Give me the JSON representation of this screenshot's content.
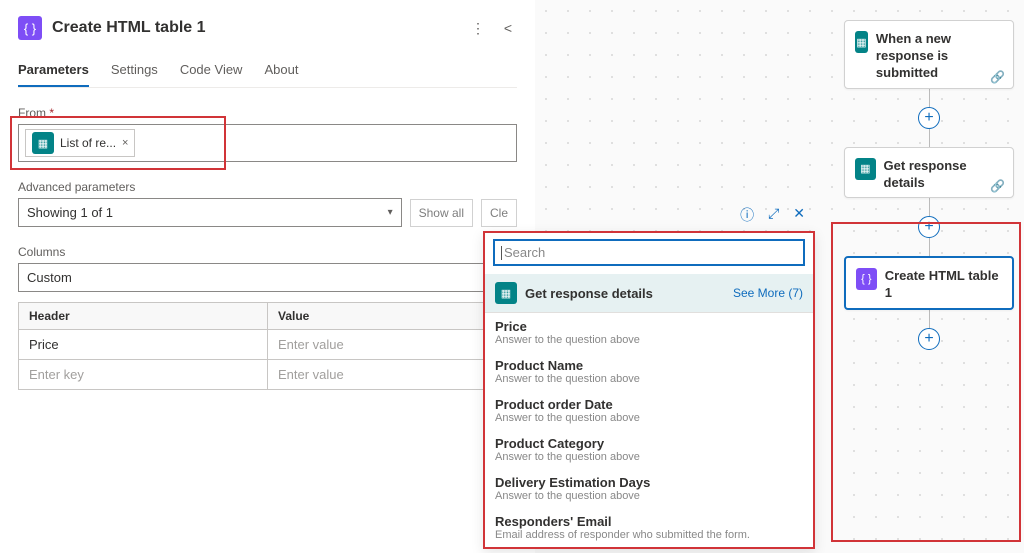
{
  "panel": {
    "title": "Create HTML table 1",
    "tabs": [
      "Parameters",
      "Settings",
      "Code View",
      "About"
    ],
    "active_tab": 0,
    "from_label": "From",
    "from_token": "List of re...",
    "adv_label": "Advanced parameters",
    "adv_value": "Showing 1 of 1",
    "show_all": "Show all",
    "clear": "Cle",
    "columns_label": "Columns",
    "columns_mode": "Custom",
    "col_header": "Header",
    "col_value": "Value",
    "rows": [
      {
        "key": "Price",
        "key_ph": false,
        "val": "Enter value",
        "val_ph": true
      },
      {
        "key": "Enter key",
        "key_ph": true,
        "val": "Enter value",
        "val_ph": true
      }
    ]
  },
  "dyn": {
    "search_ph": "Search",
    "group_title": "Get response details",
    "see_more": "See More (7)",
    "items": [
      {
        "t": "Price",
        "d": "Answer to the question above"
      },
      {
        "t": "Product Name",
        "d": "Answer to the question above"
      },
      {
        "t": "Product order Date",
        "d": "Answer to the question above"
      },
      {
        "t": "Product Category",
        "d": "Answer to the question above"
      },
      {
        "t": "Delivery Estimation Days",
        "d": "Answer to the question above"
      },
      {
        "t": "Responders' Email",
        "d": "Email address of responder who submitted the form."
      }
    ]
  },
  "flow": {
    "nodes": [
      {
        "title": "When a new response is submitted",
        "icon": "teal"
      },
      {
        "title": "Get response details",
        "icon": "teal"
      },
      {
        "title": "Create HTML table 1",
        "icon": "purple",
        "selected": true
      }
    ]
  }
}
